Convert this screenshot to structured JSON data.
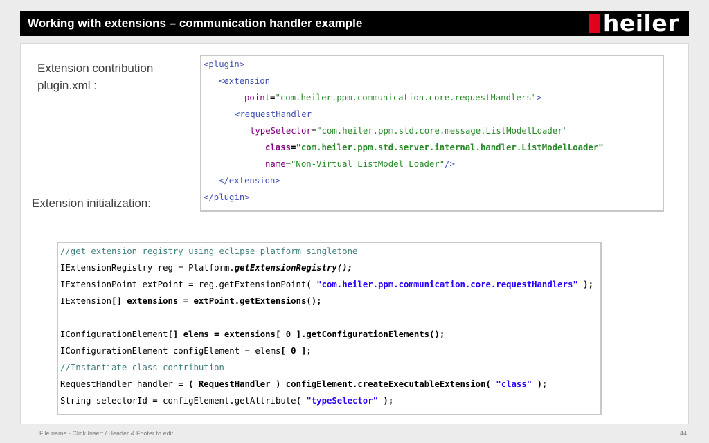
{
  "header": {
    "title": "Working with extensions – communication handler example",
    "logo_text": "heiler",
    "logo_color": "#e2001a"
  },
  "labels": {
    "contribution": "Extension contribution\nplugin.xml :",
    "initialization": "Extension initialization:"
  },
  "xml": {
    "l1": "<plugin>",
    "l2": "<extension",
    "l3_attr": "point",
    "l3_val": "\"com.heiler.ppm.communication.core.requestHandlers\"",
    "l3_end": ">",
    "l4": "<requestHandler",
    "l5_attr": "typeSelector",
    "l5_val": "\"com.heiler.ppm.std.core.message.ListModelLoader\"",
    "l6_attr": "class",
    "l6_val": "\"com.heiler.ppm.std.server.internal.handler.ListModelLoader\"",
    "l7_attr": "name",
    "l7_val": "\"Non-Virtual ListModel Loader\"",
    "l7_end": "/>",
    "l8": "</extension>",
    "l9": "</plugin>"
  },
  "java": {
    "c1": "//get extension registry using eclipse platform singletone",
    "l2a": "IExtensionRegistry reg = Platform.",
    "l2b": "getExtensionRegistry();",
    "l3a": "IExtensionPoint extPoint = reg.getExtensionPoint",
    "l3b": "( ",
    "l3c": "\"com.heiler.ppm.communication.core.requestHandlers\"",
    "l3d": " );",
    "l4a": "IExtension",
    "l4b": "[] extensions = extPoint.getExtensions();",
    "l6a": "IConfigurationElement",
    "l6b": "[] elems = extensions[ 0 ].getConfigurationElements();",
    "l7a": "IConfigurationElement configElement = elems",
    "l7b": "[ 0 ];",
    "c8": "//Instantiate class contribution",
    "l9a": "RequestHandler handler = ",
    "l9b": "( RequestHandler ) configElement.createExecutableExtension( ",
    "l9c": "\"class\"",
    "l9d": " );",
    "l10a": "String selectorId = configElement.getAttribute",
    "l10b": "( ",
    "l10c": "\"typeSelector\"",
    "l10d": " );"
  },
  "footer": {
    "left": "File name - Click Insert / Header & Footer to edit",
    "page": "44"
  }
}
